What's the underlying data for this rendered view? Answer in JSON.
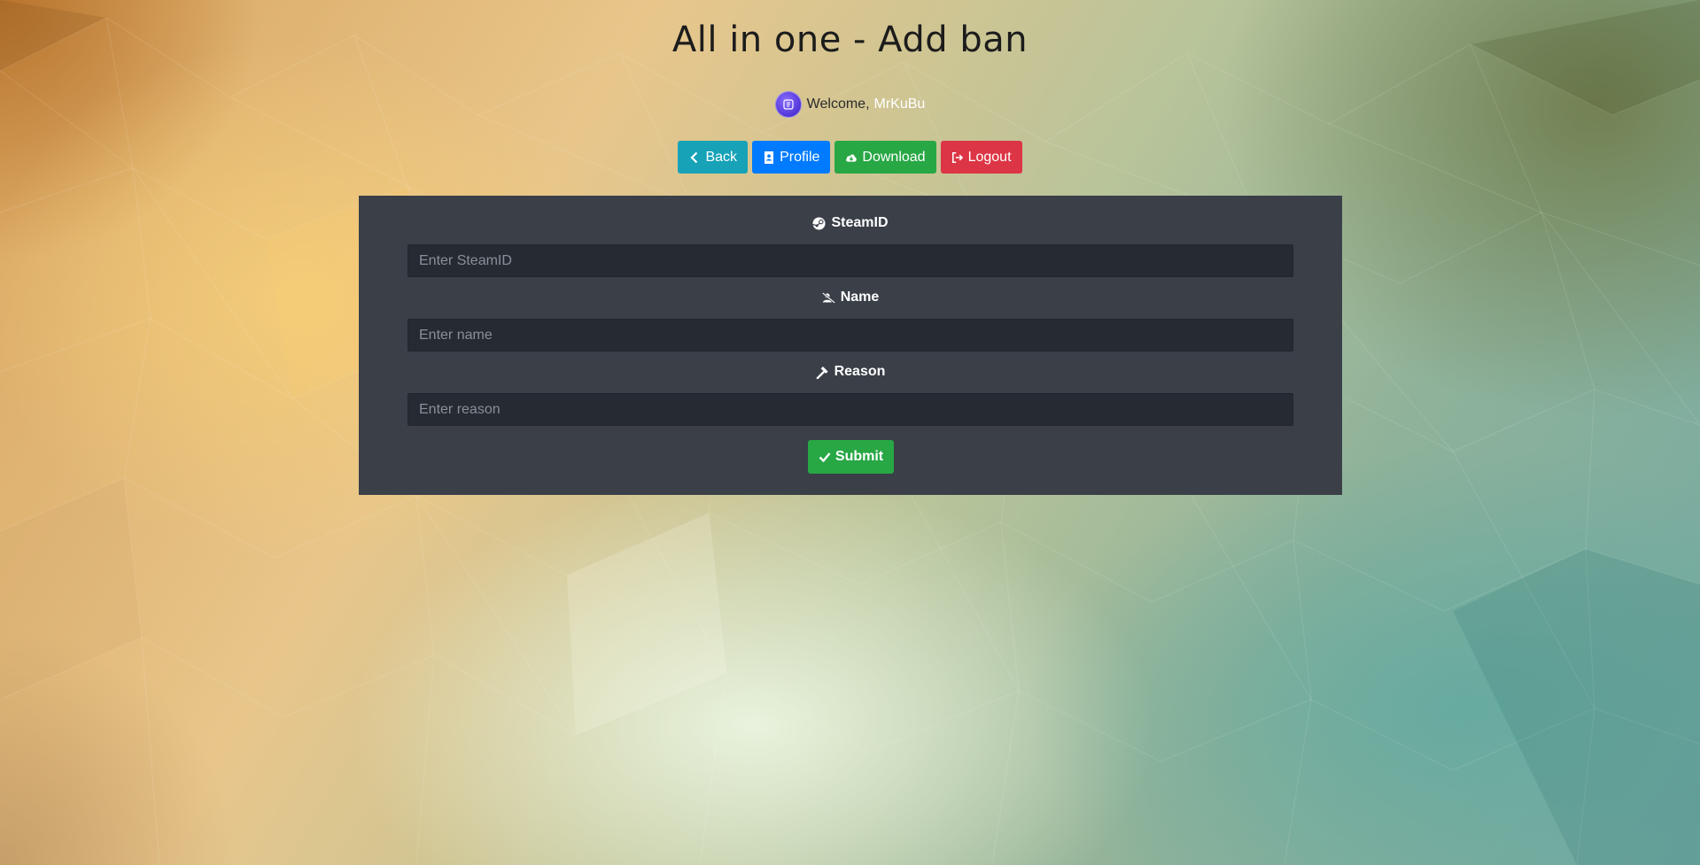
{
  "page": {
    "title": "All in one - Add ban"
  },
  "welcome": {
    "prefix": "Welcome,",
    "username": "MrKuBu",
    "avatar_icon": "avatar-logo-icon"
  },
  "nav": {
    "back": {
      "label": "Back",
      "icon": "chevron-left-icon",
      "color": "#17a2b8"
    },
    "profile": {
      "label": "Profile",
      "icon": "id-badge-icon",
      "color": "#007bff"
    },
    "download": {
      "label": "Download",
      "icon": "cloud-download-icon",
      "color": "#28a745"
    },
    "logout": {
      "label": "Logout",
      "icon": "sign-out-icon",
      "color": "#dc3545"
    }
  },
  "form": {
    "steamid": {
      "label": "SteamID",
      "icon": "steam-icon",
      "placeholder": "Enter SteamID",
      "value": ""
    },
    "name": {
      "label": "Name",
      "icon": "user-slash-icon",
      "placeholder": "Enter name",
      "value": ""
    },
    "reason": {
      "label": "Reason",
      "icon": "gavel-icon",
      "placeholder": "Enter reason",
      "value": ""
    },
    "submit": {
      "label": "Submit",
      "icon": "check-icon",
      "color": "#28a745"
    }
  }
}
